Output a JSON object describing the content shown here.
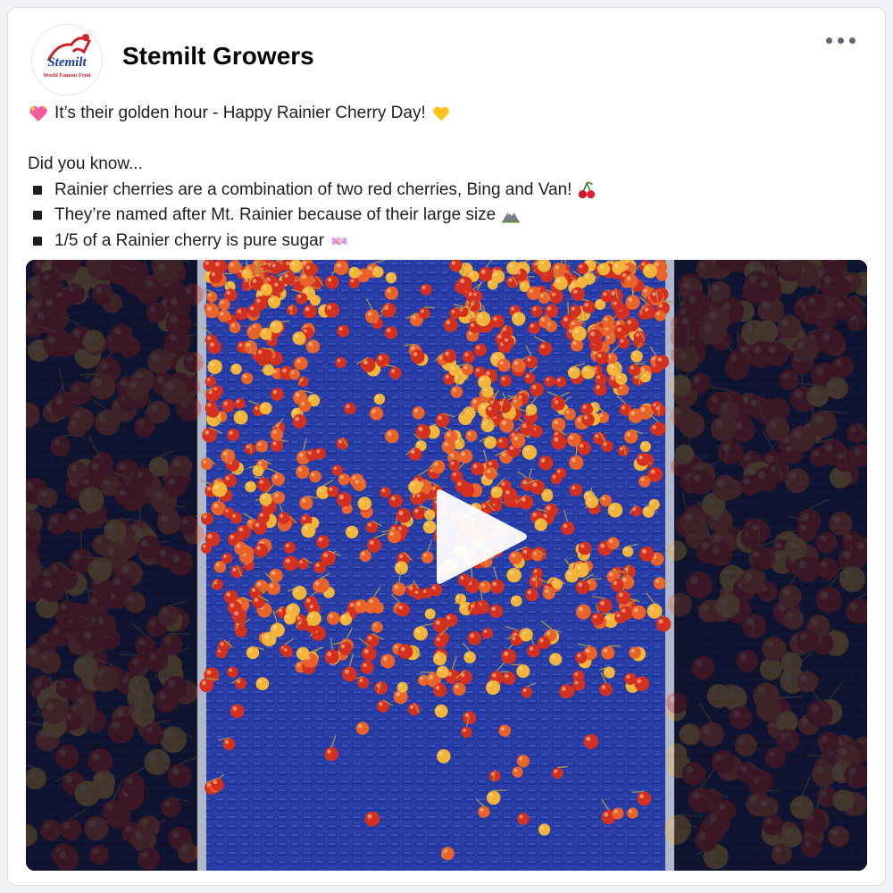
{
  "post": {
    "author": "Stemilt Growers",
    "avatar_logo_text": "Stemilt",
    "avatar_tagline": "World Famous Fruit",
    "more_icon": "more-horizontal-icon",
    "headline": "It’s their golden hour - Happy Rainier Cherry Day!",
    "headline_emoji_before": "sparkling-heart",
    "headline_emoji_after": "yellow-heart",
    "intro": "Did you know...",
    "facts": [
      {
        "text": "Rainier cherries are a combination of two red cherries, Bing and Van!",
        "emoji": "cherries"
      },
      {
        "text": "They’re named after Mt. Rainier because of their large size",
        "emoji": "mountain"
      },
      {
        "text": "1/5 of a Rainier cherry is pure sugar",
        "emoji": "candy"
      }
    ]
  },
  "video": {
    "play_icon": "play-icon",
    "colors": {
      "belt": "#2b3fa8",
      "belt_dark": "#1f2f86",
      "cherry_red": "#d4301f",
      "cherry_yellow": "#f2b53a",
      "rail": "#c9ccd1"
    }
  }
}
